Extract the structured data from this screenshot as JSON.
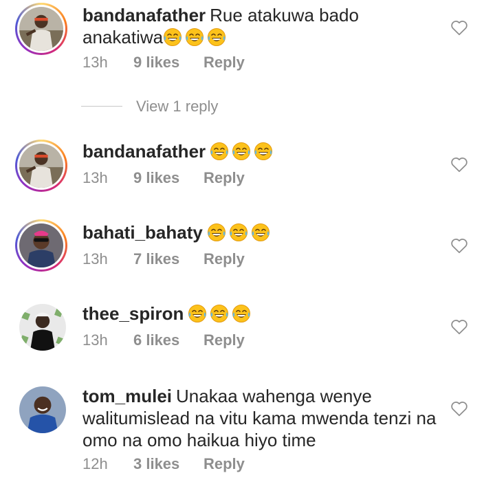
{
  "comments": [
    {
      "username": "bandanafather",
      "text": "Rue atakuwa bado anakatiwa",
      "emoji_count": 3,
      "time": "13h",
      "likes": "9 likes",
      "reply": "Reply",
      "avatar": "avatar-bandanafather-icon",
      "story_ring": true
    },
    {
      "username": "bandanafather",
      "text": "",
      "emoji_count": 3,
      "time": "13h",
      "likes": "9 likes",
      "reply": "Reply",
      "avatar": "avatar-bandanafather-icon",
      "story_ring": true
    },
    {
      "username": "bahati_bahaty",
      "text": "",
      "emoji_count": 3,
      "time": "13h",
      "likes": "7 likes",
      "reply": "Reply",
      "avatar": "avatar-bahati-icon",
      "story_ring": true
    },
    {
      "username": "thee_spiron",
      "text": "",
      "emoji_count": 3,
      "time": "13h",
      "likes": "6 likes",
      "reply": "Reply",
      "avatar": "avatar-spiron-icon",
      "story_ring": false
    },
    {
      "username": "tom_mulei",
      "text": "Unakaa wahenga wenye walitumislead na vitu kama mwenda tenzi na omo na omo haikua hiyo time",
      "emoji_count": 0,
      "time": "12h",
      "likes": "3 likes",
      "reply": "Reply",
      "avatar": "avatar-tom-icon",
      "story_ring": false
    }
  ],
  "view_replies": "View 1 reply",
  "emoji_icon": "face-with-tears-of-joy-icon",
  "heart_icon": "heart-outline-icon",
  "colors": {
    "text": "#262626",
    "meta": "#8e8e8e",
    "emoji": "#fcc21b"
  }
}
